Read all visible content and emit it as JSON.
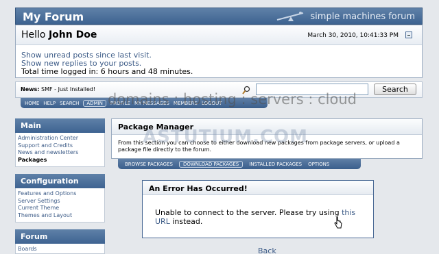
{
  "header": {
    "title": "My Forum",
    "logo_text": "simple machines forum"
  },
  "user": {
    "greeting": "Hello",
    "name": "John Doe",
    "datetime": "March 30, 2010, 10:41:33 PM",
    "links": [
      "Show unread posts since last visit.",
      "Show new replies to your posts."
    ],
    "time_logged": "Total time logged in: 6 hours and 48 minutes."
  },
  "news": {
    "label": "News:",
    "text": "SMF - Just Installed!"
  },
  "search": {
    "button_label": "Search",
    "value": ""
  },
  "main_menu": [
    "HOME",
    "HELP",
    "SEARCH",
    "ADMIN",
    "PROFILE",
    "MY MESSAGES",
    "MEMBERS",
    "LOGOUT"
  ],
  "watermarks": [
    "domains : hosting : servers : cloud",
    "ASTUTIUM.COM"
  ],
  "sidebar": {
    "main": {
      "heading": "Main",
      "items": [
        "Administration Center",
        "Support and Credits",
        "News and newsletters",
        "Packages"
      ]
    },
    "configuration": {
      "heading": "Configuration",
      "items": [
        "Features and Options",
        "Server Settings",
        "Current Theme",
        "Themes and Layout"
      ]
    },
    "forum": {
      "heading": "Forum",
      "items": [
        "Boards"
      ]
    }
  },
  "package_manager": {
    "title": "Package Manager",
    "description": "From this section you can choose to either download new packages from package servers, or upload a package file directly to the forum.",
    "tabs": [
      "BROWSE PACKAGES",
      "DOWNLOAD PACKAGES",
      "INSTALLED PACKAGES",
      "OPTIONS"
    ]
  },
  "error": {
    "title": "An Error Has Occurred!",
    "message_before": "Unable to connect to the server. Please try using ",
    "link_text": "this URL",
    "message_after": " instead."
  },
  "back_label": "Back",
  "colors": {
    "header_blue": "#3e6391",
    "link_blue": "#3b5a86",
    "page_bg": "#e5e8ec"
  }
}
